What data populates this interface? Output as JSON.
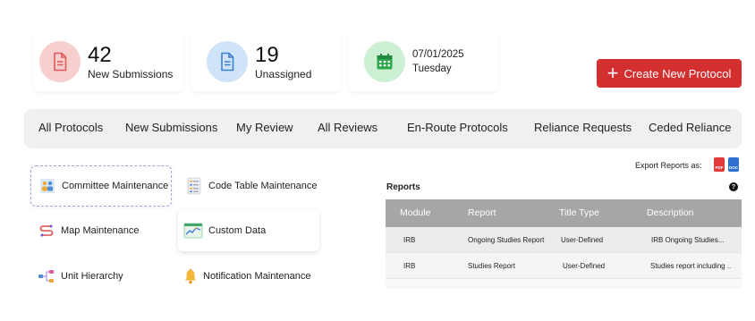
{
  "stats": {
    "new_submissions": {
      "count": "42",
      "label": "New Submissions"
    },
    "unassigned": {
      "count": "19",
      "label": "Unassigned"
    },
    "date": {
      "value": "07/01/2025",
      "day": "Tuesday"
    }
  },
  "create_button": {
    "label": "Create New Protocol",
    "icon": "plus-icon"
  },
  "nav": {
    "items": [
      "All Protocols",
      "New Submissions",
      "My Review",
      "All Reviews",
      "En-Route Protocols",
      "Reliance Requests",
      "Ceded Reliance"
    ]
  },
  "maintenance": {
    "items": [
      {
        "label": "Committee Maintenance",
        "icon": "committee-icon"
      },
      {
        "label": "Code Table Maintenance",
        "icon": "code-table-icon"
      },
      {
        "label": "Map Maintenance",
        "icon": "map-icon"
      },
      {
        "label": "Custom Data",
        "icon": "custom-data-icon"
      },
      {
        "label": "Unit Hierarchy",
        "icon": "hierarchy-icon"
      },
      {
        "label": "Notification Maintenance",
        "icon": "bell-icon"
      }
    ]
  },
  "reports": {
    "export_label": "Export Reports as:",
    "pdf_label": "PDF",
    "doc_label": "DOC",
    "title": "Reports",
    "help": "?",
    "columns": [
      "Module",
      "Report",
      "Title Type",
      "Description"
    ],
    "rows": [
      [
        "IRB",
        "Ongoing Studies Report",
        "User-Defined",
        "IRB Ongoing Studies..."
      ],
      [
        "IRB",
        "Studies Report",
        "User-Defined",
        "Studies report including .."
      ]
    ]
  },
  "colors": {
    "accent_red": "#d32f2f",
    "pink_circle": "#f8cfcf",
    "blue_circle": "#cfe4f8",
    "green_circle": "#cdf0d4",
    "table_header": "#a6a6a6"
  }
}
